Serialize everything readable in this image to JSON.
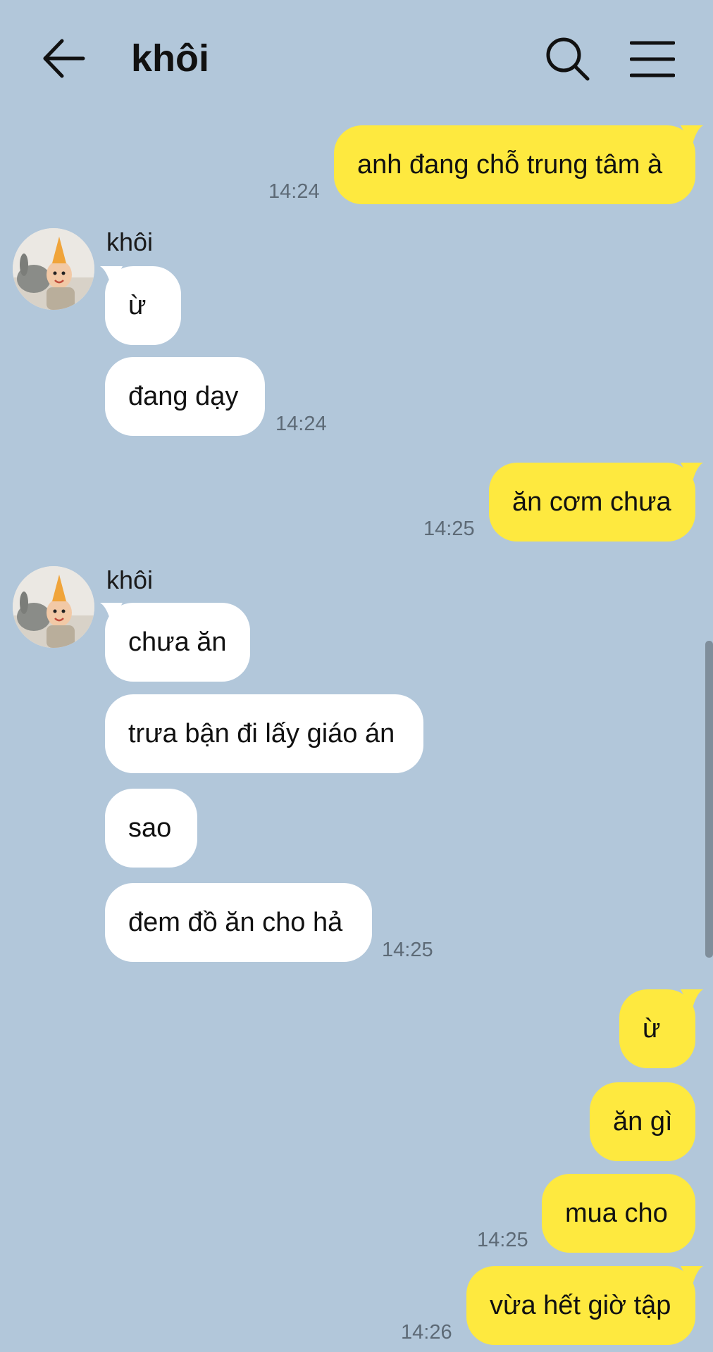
{
  "header": {
    "title": "khôi"
  },
  "messages": {
    "m1": {
      "text": "anh đang chỗ trung tâm à",
      "time": "14:24"
    },
    "g1": {
      "sender": "khôi"
    },
    "m2": {
      "text": "ừ"
    },
    "m3": {
      "text": "đang dạy",
      "time": "14:24"
    },
    "m4": {
      "text": "ăn cơm chưa",
      "time": "14:25"
    },
    "g2": {
      "sender": "khôi"
    },
    "m5": {
      "text": "chưa ăn"
    },
    "m6": {
      "text": "trưa bận đi lấy giáo án"
    },
    "m7": {
      "text": "sao"
    },
    "m8": {
      "text": "đem đồ ăn cho hả",
      "time": "14:25"
    },
    "m9": {
      "text": "ừ"
    },
    "m10": {
      "text": "ăn gì"
    },
    "m11": {
      "text": "mua cho",
      "time": "14:25"
    },
    "m12": {
      "text": "vừa hết giờ tập",
      "time": "14:26"
    }
  },
  "icons": {
    "back": "arrow-left-icon",
    "search": "search-icon",
    "menu": "hamburger-menu-icon",
    "avatar": "avatar-child-with-rabbit"
  },
  "colors": {
    "background": "#b2c7da",
    "mine_bubble": "#fee93f",
    "their_bubble": "#ffffff",
    "timestamp": "#5d6a76"
  }
}
